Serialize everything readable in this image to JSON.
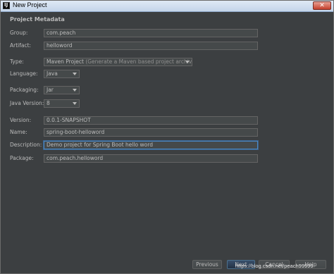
{
  "window": {
    "title": "New Project",
    "app_icon_text": "IJ"
  },
  "section": {
    "title": "Project Metadata"
  },
  "fields": {
    "group": {
      "label": "Group:",
      "value": "com.peach"
    },
    "artifact": {
      "label": "Artifact:",
      "value": "helloword"
    },
    "type": {
      "label": "Type:",
      "value": "Maven Project",
      "hint": "(Generate a Maven based project archive)"
    },
    "language": {
      "label": "Language:",
      "value": "Java"
    },
    "packaging": {
      "label": "Packaging:",
      "value": "Jar"
    },
    "java_version": {
      "label": "Java Version:",
      "value": "8"
    },
    "version": {
      "label": "Version:",
      "value": "0.0.1-SNAPSHOT"
    },
    "name": {
      "label": "Name:",
      "value": "spring-boot-helloword"
    },
    "description": {
      "label": "Description:",
      "value": "Demo project for Spring Boot hello word"
    },
    "package": {
      "label": "Package:",
      "value": "com.peach.helloword"
    }
  },
  "buttons": {
    "previous": "Previous",
    "next": "Next",
    "cancel": "Cancel",
    "help": "Help"
  },
  "watermark": "https://blog.csdn.net/peach99999"
}
